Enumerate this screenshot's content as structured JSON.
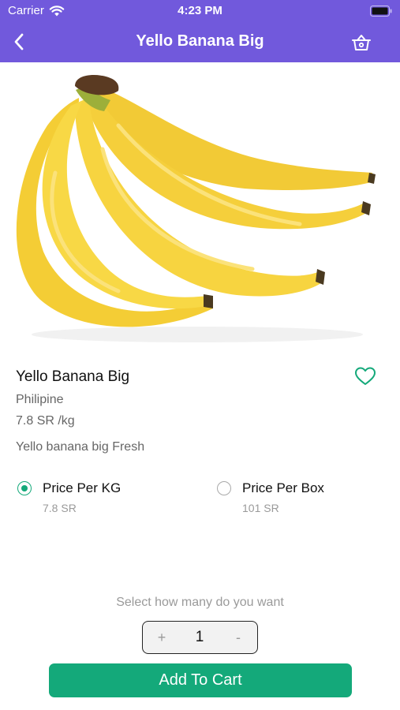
{
  "status_bar": {
    "carrier": "Carrier",
    "time": "4:23 PM"
  },
  "nav": {
    "title": "Yello Banana Big",
    "back_icon": "chevron-left-icon",
    "cart_icon": "basket-icon"
  },
  "product": {
    "image": "banana-bunch-image",
    "title": "Yello Banana Big",
    "origin": "Philipine",
    "unit_price": "7.8 SR /kg",
    "description": "Yello banana big Fresh",
    "favorite_icon": "heart-outline-icon"
  },
  "options": [
    {
      "label": "Price Per KG",
      "price": "7.8 SR",
      "selected": true
    },
    {
      "label": "Price Per Box",
      "price": "101 SR",
      "selected": false
    }
  ],
  "quantity": {
    "prompt": "Select how many do you want",
    "plus": "+",
    "value": "1",
    "minus": "-"
  },
  "cart_button": {
    "label": "Add To Cart"
  },
  "colors": {
    "header": "#7159dc",
    "accent": "#14a97a"
  }
}
